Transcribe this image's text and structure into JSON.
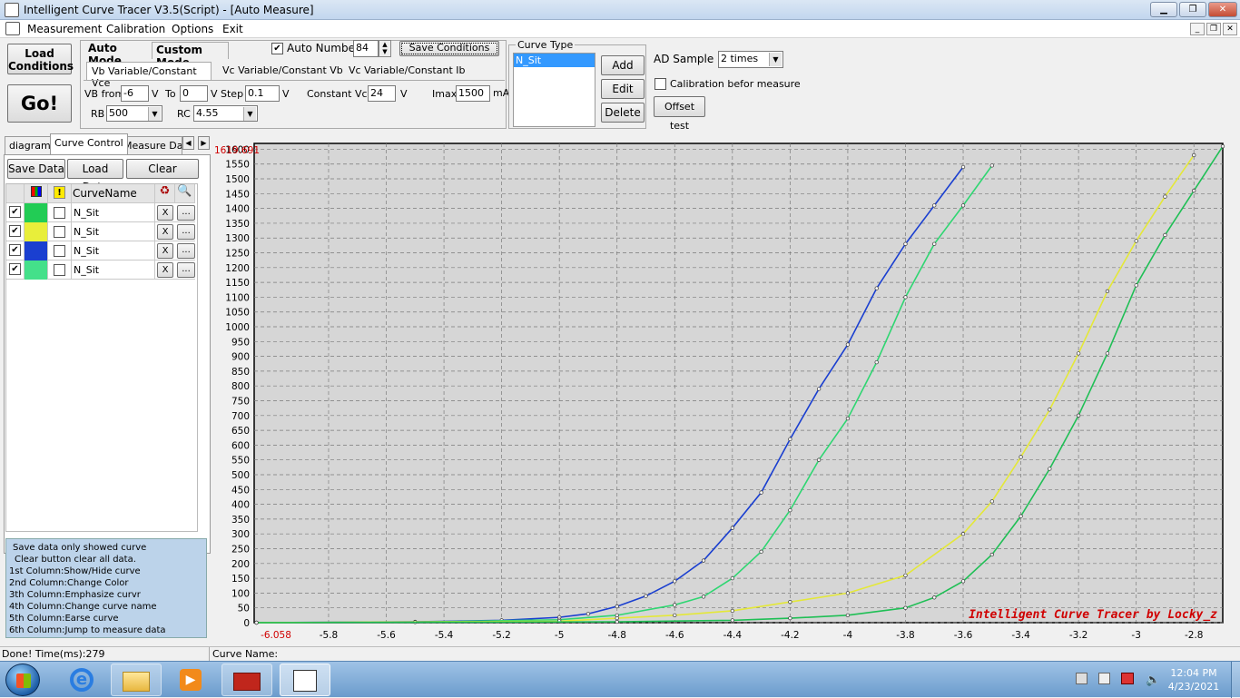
{
  "window": {
    "title": "Intelligent Curve Tracer V3.5(Script) - [Auto Measure]"
  },
  "menu": [
    "Measurement",
    "Calibration",
    "Options",
    "Exit"
  ],
  "left_buttons": {
    "load": "Load\nConditions",
    "go": "Go!"
  },
  "mode_tabs": [
    "Auto Mode",
    "Custom Mode"
  ],
  "auto_number": {
    "label": "Auto Number",
    "checked": true,
    "value": "84"
  },
  "save_conditions": "Save Conditions",
  "subtabs": [
    "Vb Variable/Constant Vce",
    "Vc Variable/Constant Vb",
    "Vc Variable/Constant Ib"
  ],
  "params": {
    "vb_from_label": "VB from",
    "vb_from": "-6",
    "v1": "V",
    "to_label": "To",
    "to": "0",
    "v2": "V",
    "step_label": "Step",
    "step": "0.1",
    "v3": "V",
    "vce_label": "Constant Vce",
    "vce": "24",
    "v4": "V",
    "imax_label": "Imax",
    "imax": "1500",
    "imax_unit": "mA",
    "rb_label": "RB",
    "rb": "500",
    "rc_label": "RC",
    "rc": "4.55"
  },
  "curve_type": {
    "title": "Curve Type",
    "items": [
      "N_Sit"
    ],
    "add": "Add",
    "edit": "Edit",
    "delete": "Delete"
  },
  "ad_sample": {
    "label": "AD Sample",
    "value": "2 times"
  },
  "calibration": {
    "label": "Calibration befor measure",
    "checked": false
  },
  "offset_test": "Offset test",
  "side_tabs": [
    "diagram",
    "Curve Control",
    "Measure Data"
  ],
  "side_buttons": [
    "Save Data",
    "Load Data",
    "Clear"
  ],
  "grid": {
    "header": "CurveName",
    "rows": [
      {
        "show": true,
        "color": "#22cc55",
        "emph": false,
        "name": "N_Sit",
        "x": "X",
        "dots": "..."
      },
      {
        "show": true,
        "color": "#e8ee3a",
        "emph": false,
        "name": "N_Sit",
        "x": "X",
        "dots": "..."
      },
      {
        "show": true,
        "color": "#1a3fd0",
        "emph": false,
        "name": "N_Sit",
        "x": "X",
        "dots": "..."
      },
      {
        "show": true,
        "color": "#44e08a",
        "emph": false,
        "name": "N_Sit",
        "x": "X",
        "dots": "..."
      }
    ]
  },
  "help_lines": [
    "Save data only showed curve",
    "Clear button clear all data.",
    "1st Column:Show/Hide curve",
    "2nd Column:Change Color",
    "3th Column:Emphasize curvr",
    "4th Column:Change curve name",
    "5th Column:Earse curve",
    "6th Column:Jump to measure data"
  ],
  "status": {
    "left": "Done!  Time(ms):279",
    "right": "Curve Name:"
  },
  "taskbar": {
    "time": "12:04 PM",
    "date": "4/23/2021"
  },
  "chart_data": {
    "type": "line",
    "watermark": "Intelligent Curve Tracer by Locky_z",
    "ymax_label": "1619.691",
    "xmin_label": "-6.058",
    "xlim": [
      -6.058,
      -2.7
    ],
    "ylim": [
      0,
      1619.691
    ],
    "grid": true,
    "x_ticks": [
      -5.8,
      -5.6,
      -5.4,
      -5.2,
      -5,
      -4.8,
      -4.6,
      -4.4,
      -4.2,
      -4,
      -3.8,
      -3.6,
      -3.4,
      -3.2,
      -3,
      -2.8
    ],
    "y_ticks": [
      0,
      50,
      100,
      150,
      200,
      250,
      300,
      350,
      400,
      450,
      500,
      550,
      600,
      650,
      700,
      750,
      800,
      850,
      900,
      950,
      1000,
      1050,
      1100,
      1150,
      1200,
      1250,
      1300,
      1350,
      1400,
      1450,
      1500,
      1550,
      1600
    ],
    "series": [
      {
        "color": "#1a3fd0",
        "x": [
          -6.05,
          -5.5,
          -5.2,
          -5.0,
          -4.9,
          -4.8,
          -4.7,
          -4.6,
          -4.5,
          -4.4,
          -4.3,
          -4.2,
          -4.1,
          -4.0,
          -3.9,
          -3.8,
          -3.7,
          -3.6
        ],
        "y": [
          0,
          3,
          8,
          18,
          30,
          55,
          90,
          140,
          210,
          320,
          440,
          620,
          790,
          940,
          1130,
          1280,
          1410,
          1540
        ]
      },
      {
        "color": "#2fd672",
        "x": [
          -6.05,
          -5.5,
          -5.0,
          -4.8,
          -4.6,
          -4.5,
          -4.4,
          -4.3,
          -4.2,
          -4.1,
          -4.0,
          -3.9,
          -3.8,
          -3.7,
          -3.6,
          -3.5
        ],
        "y": [
          0,
          2,
          10,
          25,
          60,
          88,
          150,
          240,
          380,
          550,
          690,
          880,
          1100,
          1280,
          1410,
          1545
        ]
      },
      {
        "color": "#e4e838",
        "x": [
          -6.05,
          -5.0,
          -4.8,
          -4.6,
          -4.4,
          -4.2,
          -4.0,
          -3.8,
          -3.6,
          -3.5,
          -3.4,
          -3.3,
          -3.2,
          -3.1,
          -3.0,
          -2.9,
          -2.8
        ],
        "y": [
          0,
          5,
          15,
          25,
          40,
          70,
          100,
          160,
          300,
          410,
          560,
          720,
          910,
          1120,
          1290,
          1440,
          1580
        ]
      },
      {
        "color": "#1fbf55",
        "x": [
          -6.05,
          -4.8,
          -4.4,
          -4.2,
          -4.0,
          -3.8,
          -3.7,
          -3.6,
          -3.5,
          -3.4,
          -3.3,
          -3.2,
          -3.1,
          -3.0,
          -2.9,
          -2.8,
          -2.7
        ],
        "y": [
          0,
          3,
          8,
          15,
          25,
          50,
          85,
          140,
          230,
          360,
          520,
          700,
          910,
          1140,
          1310,
          1460,
          1610
        ]
      }
    ]
  }
}
